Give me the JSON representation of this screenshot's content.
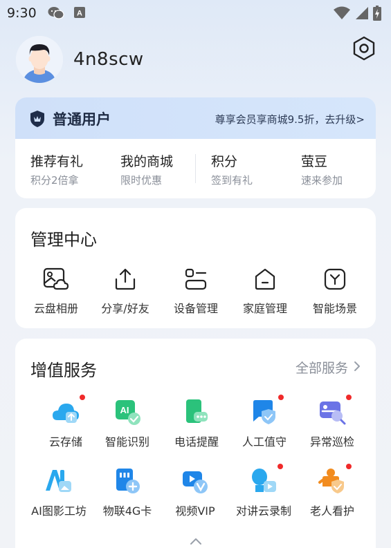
{
  "status_bar": {
    "time": "9:30",
    "notif_letter": "A"
  },
  "profile": {
    "username": "4n8scw"
  },
  "membership": {
    "level": "普通用户",
    "promo": "尊享会员享商城9.5折，去升级>",
    "items": [
      {
        "title": "推荐有礼",
        "subtitle": "积分2倍拿"
      },
      {
        "title": "我的商城",
        "subtitle": "限时优惠"
      },
      {
        "title": "积分",
        "subtitle": "签到有礼"
      },
      {
        "title": "萤豆",
        "subtitle": "速来参加"
      }
    ]
  },
  "management": {
    "title": "管理中心",
    "items": [
      {
        "label": "云盘相册",
        "icon": "photo-cloud-icon"
      },
      {
        "label": "分享/好友",
        "icon": "share-icon"
      },
      {
        "label": "设备管理",
        "icon": "device-icon"
      },
      {
        "label": "家庭管理",
        "icon": "home-icon"
      },
      {
        "label": "智能场景",
        "icon": "scene-icon"
      }
    ]
  },
  "services": {
    "title": "增值服务",
    "all_label": "全部服务",
    "items": [
      {
        "label": "云存储",
        "icon": "cloud-storage-icon",
        "badge": true
      },
      {
        "label": "智能识别",
        "icon": "ai-recognition-icon",
        "badge": false
      },
      {
        "label": "电话提醒",
        "icon": "phone-alert-icon",
        "badge": false
      },
      {
        "label": "人工值守",
        "icon": "manual-guard-icon",
        "badge": true
      },
      {
        "label": "异常巡检",
        "icon": "inspection-icon",
        "badge": true
      },
      {
        "label": "AI图影工坊",
        "icon": "ai-studio-icon",
        "badge": false
      },
      {
        "label": "物联4G卡",
        "icon": "sim-card-icon",
        "badge": false
      },
      {
        "label": "视频VIP",
        "icon": "video-vip-icon",
        "badge": false
      },
      {
        "label": "对讲云录制",
        "icon": "intercom-record-icon",
        "badge": true
      },
      {
        "label": "老人看护",
        "icon": "elder-care-icon",
        "badge": true
      }
    ]
  }
}
